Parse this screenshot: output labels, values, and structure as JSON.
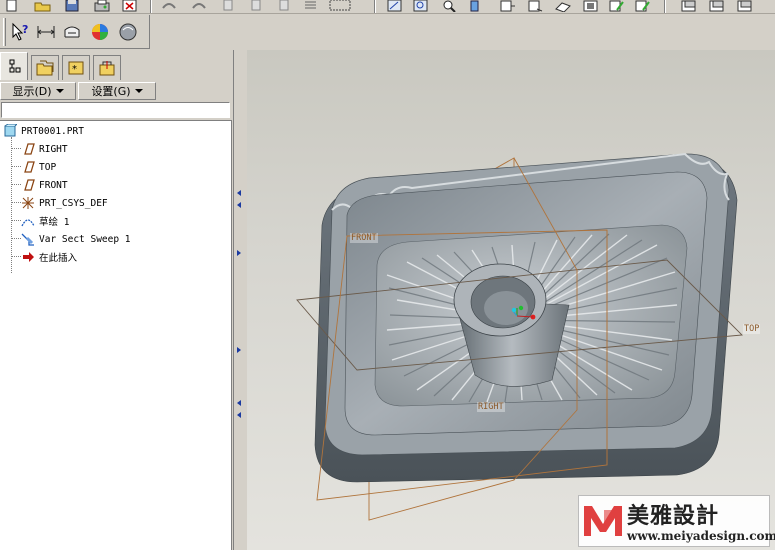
{
  "panel": {
    "menus": [
      {
        "label": "显示(D)"
      },
      {
        "label": "设置(G)"
      }
    ]
  },
  "model_tree": {
    "items": [
      {
        "label": "PRT0001.PRT",
        "icon": "part-icon"
      },
      {
        "label": "RIGHT",
        "icon": "datum-plane-icon"
      },
      {
        "label": "TOP",
        "icon": "datum-plane-icon"
      },
      {
        "label": "FRONT",
        "icon": "datum-plane-icon"
      },
      {
        "label": "PRT_CSYS_DEF",
        "icon": "csys-icon"
      },
      {
        "label": "草绘 1",
        "icon": "sketch-icon"
      },
      {
        "label": "Var Sect Sweep 1",
        "icon": "sweep-icon"
      },
      {
        "label": "在此插入",
        "icon": "insert-here-arrow-icon"
      }
    ]
  },
  "viewport": {
    "plane_labels": {
      "front": "FRONT",
      "top": "TOP",
      "right": "RIGHT"
    },
    "colors": {
      "model": "#8f979d",
      "datum_plane": "#b0743c",
      "background": "#d6d5cf"
    }
  },
  "watermark": {
    "title": "美雅設計",
    "url": "www.meiyadesign.com"
  }
}
